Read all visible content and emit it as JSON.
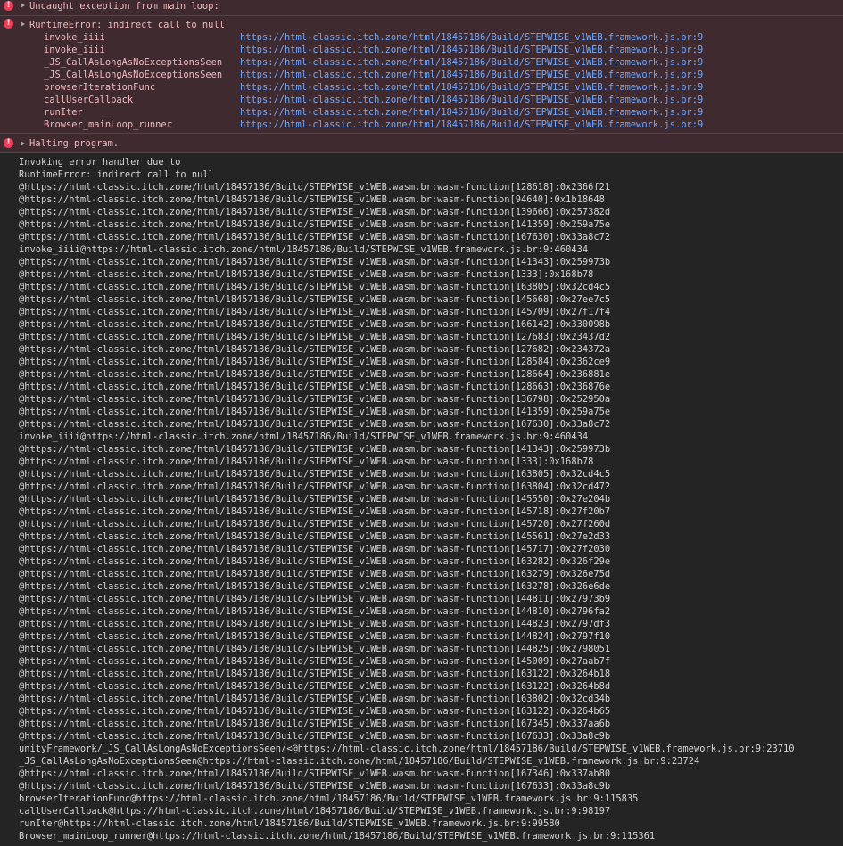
{
  "errors": [
    {
      "message": "Uncaught exception from main loop:"
    },
    {
      "message": "RuntimeError: indirect call to null",
      "frames": [
        {
          "fn": "invoke_iiii",
          "src": "https://html-classic.itch.zone/html/18457186/Build/STEPWISE_v1WEB.framework.js.br:9"
        },
        {
          "fn": "invoke_iiii",
          "src": "https://html-classic.itch.zone/html/18457186/Build/STEPWISE_v1WEB.framework.js.br:9"
        },
        {
          "fn": "_JS_CallAsLongAsNoExceptionsSeen",
          "src": "https://html-classic.itch.zone/html/18457186/Build/STEPWISE_v1WEB.framework.js.br:9"
        },
        {
          "fn": "_JS_CallAsLongAsNoExceptionsSeen",
          "src": "https://html-classic.itch.zone/html/18457186/Build/STEPWISE_v1WEB.framework.js.br:9"
        },
        {
          "fn": "browserIterationFunc",
          "src": "https://html-classic.itch.zone/html/18457186/Build/STEPWISE_v1WEB.framework.js.br:9"
        },
        {
          "fn": "callUserCallback",
          "src": "https://html-classic.itch.zone/html/18457186/Build/STEPWISE_v1WEB.framework.js.br:9"
        },
        {
          "fn": "runIter",
          "src": "https://html-classic.itch.zone/html/18457186/Build/STEPWISE_v1WEB.framework.js.br:9"
        },
        {
          "fn": "Browser_mainLoop_runner",
          "src": "https://html-classic.itch.zone/html/18457186/Build/STEPWISE_v1WEB.framework.js.br:9"
        }
      ]
    },
    {
      "message": "Halting program."
    }
  ],
  "log_lines": [
    "Invoking error handler due to",
    "RuntimeError: indirect call to null",
    "@https://html-classic.itch.zone/html/18457186/Build/STEPWISE_v1WEB.wasm.br:wasm-function[128618]:0x2366f21",
    "@https://html-classic.itch.zone/html/18457186/Build/STEPWISE_v1WEB.wasm.br:wasm-function[94640]:0x1b18648",
    "@https://html-classic.itch.zone/html/18457186/Build/STEPWISE_v1WEB.wasm.br:wasm-function[139666]:0x257382d",
    "@https://html-classic.itch.zone/html/18457186/Build/STEPWISE_v1WEB.wasm.br:wasm-function[141359]:0x259a75e",
    "@https://html-classic.itch.zone/html/18457186/Build/STEPWISE_v1WEB.wasm.br:wasm-function[167630]:0x33a8c72",
    "invoke_iiii@https://html-classic.itch.zone/html/18457186/Build/STEPWISE_v1WEB.framework.js.br:9:460434",
    "@https://html-classic.itch.zone/html/18457186/Build/STEPWISE_v1WEB.wasm.br:wasm-function[141343]:0x259973b",
    "@https://html-classic.itch.zone/html/18457186/Build/STEPWISE_v1WEB.wasm.br:wasm-function[1333]:0x168b78",
    "@https://html-classic.itch.zone/html/18457186/Build/STEPWISE_v1WEB.wasm.br:wasm-function[163805]:0x32cd4c5",
    "@https://html-classic.itch.zone/html/18457186/Build/STEPWISE_v1WEB.wasm.br:wasm-function[145668]:0x27ee7c5",
    "@https://html-classic.itch.zone/html/18457186/Build/STEPWISE_v1WEB.wasm.br:wasm-function[145709]:0x27f17f4",
    "@https://html-classic.itch.zone/html/18457186/Build/STEPWISE_v1WEB.wasm.br:wasm-function[166142]:0x330098b",
    "@https://html-classic.itch.zone/html/18457186/Build/STEPWISE_v1WEB.wasm.br:wasm-function[127683]:0x23437d2",
    "@https://html-classic.itch.zone/html/18457186/Build/STEPWISE_v1WEB.wasm.br:wasm-function[127682]:0x234372a",
    "@https://html-classic.itch.zone/html/18457186/Build/STEPWISE_v1WEB.wasm.br:wasm-function[128584]:0x2362ce9",
    "@https://html-classic.itch.zone/html/18457186/Build/STEPWISE_v1WEB.wasm.br:wasm-function[128664]:0x236881e",
    "@https://html-classic.itch.zone/html/18457186/Build/STEPWISE_v1WEB.wasm.br:wasm-function[128663]:0x236876e",
    "@https://html-classic.itch.zone/html/18457186/Build/STEPWISE_v1WEB.wasm.br:wasm-function[136798]:0x252950a",
    "@https://html-classic.itch.zone/html/18457186/Build/STEPWISE_v1WEB.wasm.br:wasm-function[141359]:0x259a75e",
    "@https://html-classic.itch.zone/html/18457186/Build/STEPWISE_v1WEB.wasm.br:wasm-function[167630]:0x33a8c72",
    "invoke_iiii@https://html-classic.itch.zone/html/18457186/Build/STEPWISE_v1WEB.framework.js.br:9:460434",
    "@https://html-classic.itch.zone/html/18457186/Build/STEPWISE_v1WEB.wasm.br:wasm-function[141343]:0x259973b",
    "@https://html-classic.itch.zone/html/18457186/Build/STEPWISE_v1WEB.wasm.br:wasm-function[1333]:0x168b78",
    "@https://html-classic.itch.zone/html/18457186/Build/STEPWISE_v1WEB.wasm.br:wasm-function[163805]:0x32cd4c5",
    "@https://html-classic.itch.zone/html/18457186/Build/STEPWISE_v1WEB.wasm.br:wasm-function[163804]:0x32cd472",
    "@https://html-classic.itch.zone/html/18457186/Build/STEPWISE_v1WEB.wasm.br:wasm-function[145550]:0x27e204b",
    "@https://html-classic.itch.zone/html/18457186/Build/STEPWISE_v1WEB.wasm.br:wasm-function[145718]:0x27f20b7",
    "@https://html-classic.itch.zone/html/18457186/Build/STEPWISE_v1WEB.wasm.br:wasm-function[145720]:0x27f260d",
    "@https://html-classic.itch.zone/html/18457186/Build/STEPWISE_v1WEB.wasm.br:wasm-function[145561]:0x27e2d33",
    "@https://html-classic.itch.zone/html/18457186/Build/STEPWISE_v1WEB.wasm.br:wasm-function[145717]:0x27f2030",
    "@https://html-classic.itch.zone/html/18457186/Build/STEPWISE_v1WEB.wasm.br:wasm-function[163282]:0x326f29e",
    "@https://html-classic.itch.zone/html/18457186/Build/STEPWISE_v1WEB.wasm.br:wasm-function[163279]:0x326e75d",
    "@https://html-classic.itch.zone/html/18457186/Build/STEPWISE_v1WEB.wasm.br:wasm-function[163278]:0x326e6de",
    "@https://html-classic.itch.zone/html/18457186/Build/STEPWISE_v1WEB.wasm.br:wasm-function[144811]:0x27973b9",
    "@https://html-classic.itch.zone/html/18457186/Build/STEPWISE_v1WEB.wasm.br:wasm-function[144810]:0x2796fa2",
    "@https://html-classic.itch.zone/html/18457186/Build/STEPWISE_v1WEB.wasm.br:wasm-function[144823]:0x2797df3",
    "@https://html-classic.itch.zone/html/18457186/Build/STEPWISE_v1WEB.wasm.br:wasm-function[144824]:0x2797f10",
    "@https://html-classic.itch.zone/html/18457186/Build/STEPWISE_v1WEB.wasm.br:wasm-function[144825]:0x2798051",
    "@https://html-classic.itch.zone/html/18457186/Build/STEPWISE_v1WEB.wasm.br:wasm-function[145009]:0x27aab7f",
    "@https://html-classic.itch.zone/html/18457186/Build/STEPWISE_v1WEB.wasm.br:wasm-function[163122]:0x3264b18",
    "@https://html-classic.itch.zone/html/18457186/Build/STEPWISE_v1WEB.wasm.br:wasm-function[163122]:0x3264b8d",
    "@https://html-classic.itch.zone/html/18457186/Build/STEPWISE_v1WEB.wasm.br:wasm-function[163802]:0x32cd34b",
    "@https://html-classic.itch.zone/html/18457186/Build/STEPWISE_v1WEB.wasm.br:wasm-function[163122]:0x3264b65",
    "@https://html-classic.itch.zone/html/18457186/Build/STEPWISE_v1WEB.wasm.br:wasm-function[167345]:0x337aa6b",
    "@https://html-classic.itch.zone/html/18457186/Build/STEPWISE_v1WEB.wasm.br:wasm-function[167633]:0x33a8c9b",
    "unityFramework/_JS_CallAsLongAsNoExceptionsSeen/<@https://html-classic.itch.zone/html/18457186/Build/STEPWISE_v1WEB.framework.js.br:9:23710",
    "_JS_CallAsLongAsNoExceptionsSeen@https://html-classic.itch.zone/html/18457186/Build/STEPWISE_v1WEB.framework.js.br:9:23724",
    "@https://html-classic.itch.zone/html/18457186/Build/STEPWISE_v1WEB.wasm.br:wasm-function[167346]:0x337ab80",
    "@https://html-classic.itch.zone/html/18457186/Build/STEPWISE_v1WEB.wasm.br:wasm-function[167633]:0x33a8c9b",
    "browserIterationFunc@https://html-classic.itch.zone/html/18457186/Build/STEPWISE_v1WEB.framework.js.br:9:115835",
    "callUserCallback@https://html-classic.itch.zone/html/18457186/Build/STEPWISE_v1WEB.framework.js.br:9:98197",
    "runIter@https://html-classic.itch.zone/html/18457186/Build/STEPWISE_v1WEB.framework.js.br:9:99580",
    "Browser_mainLoop_runner@https://html-classic.itch.zone/html/18457186/Build/STEPWISE_v1WEB.framework.js.br:9:115361"
  ],
  "icons": {
    "error": "!"
  },
  "colors": {
    "background": "#242424",
    "error_background": "#3f2a30",
    "error_text": "#f0b8bf",
    "error_icon": "#e8405a",
    "link": "#6ea8ff",
    "log_text": "#d4d4d4"
  }
}
